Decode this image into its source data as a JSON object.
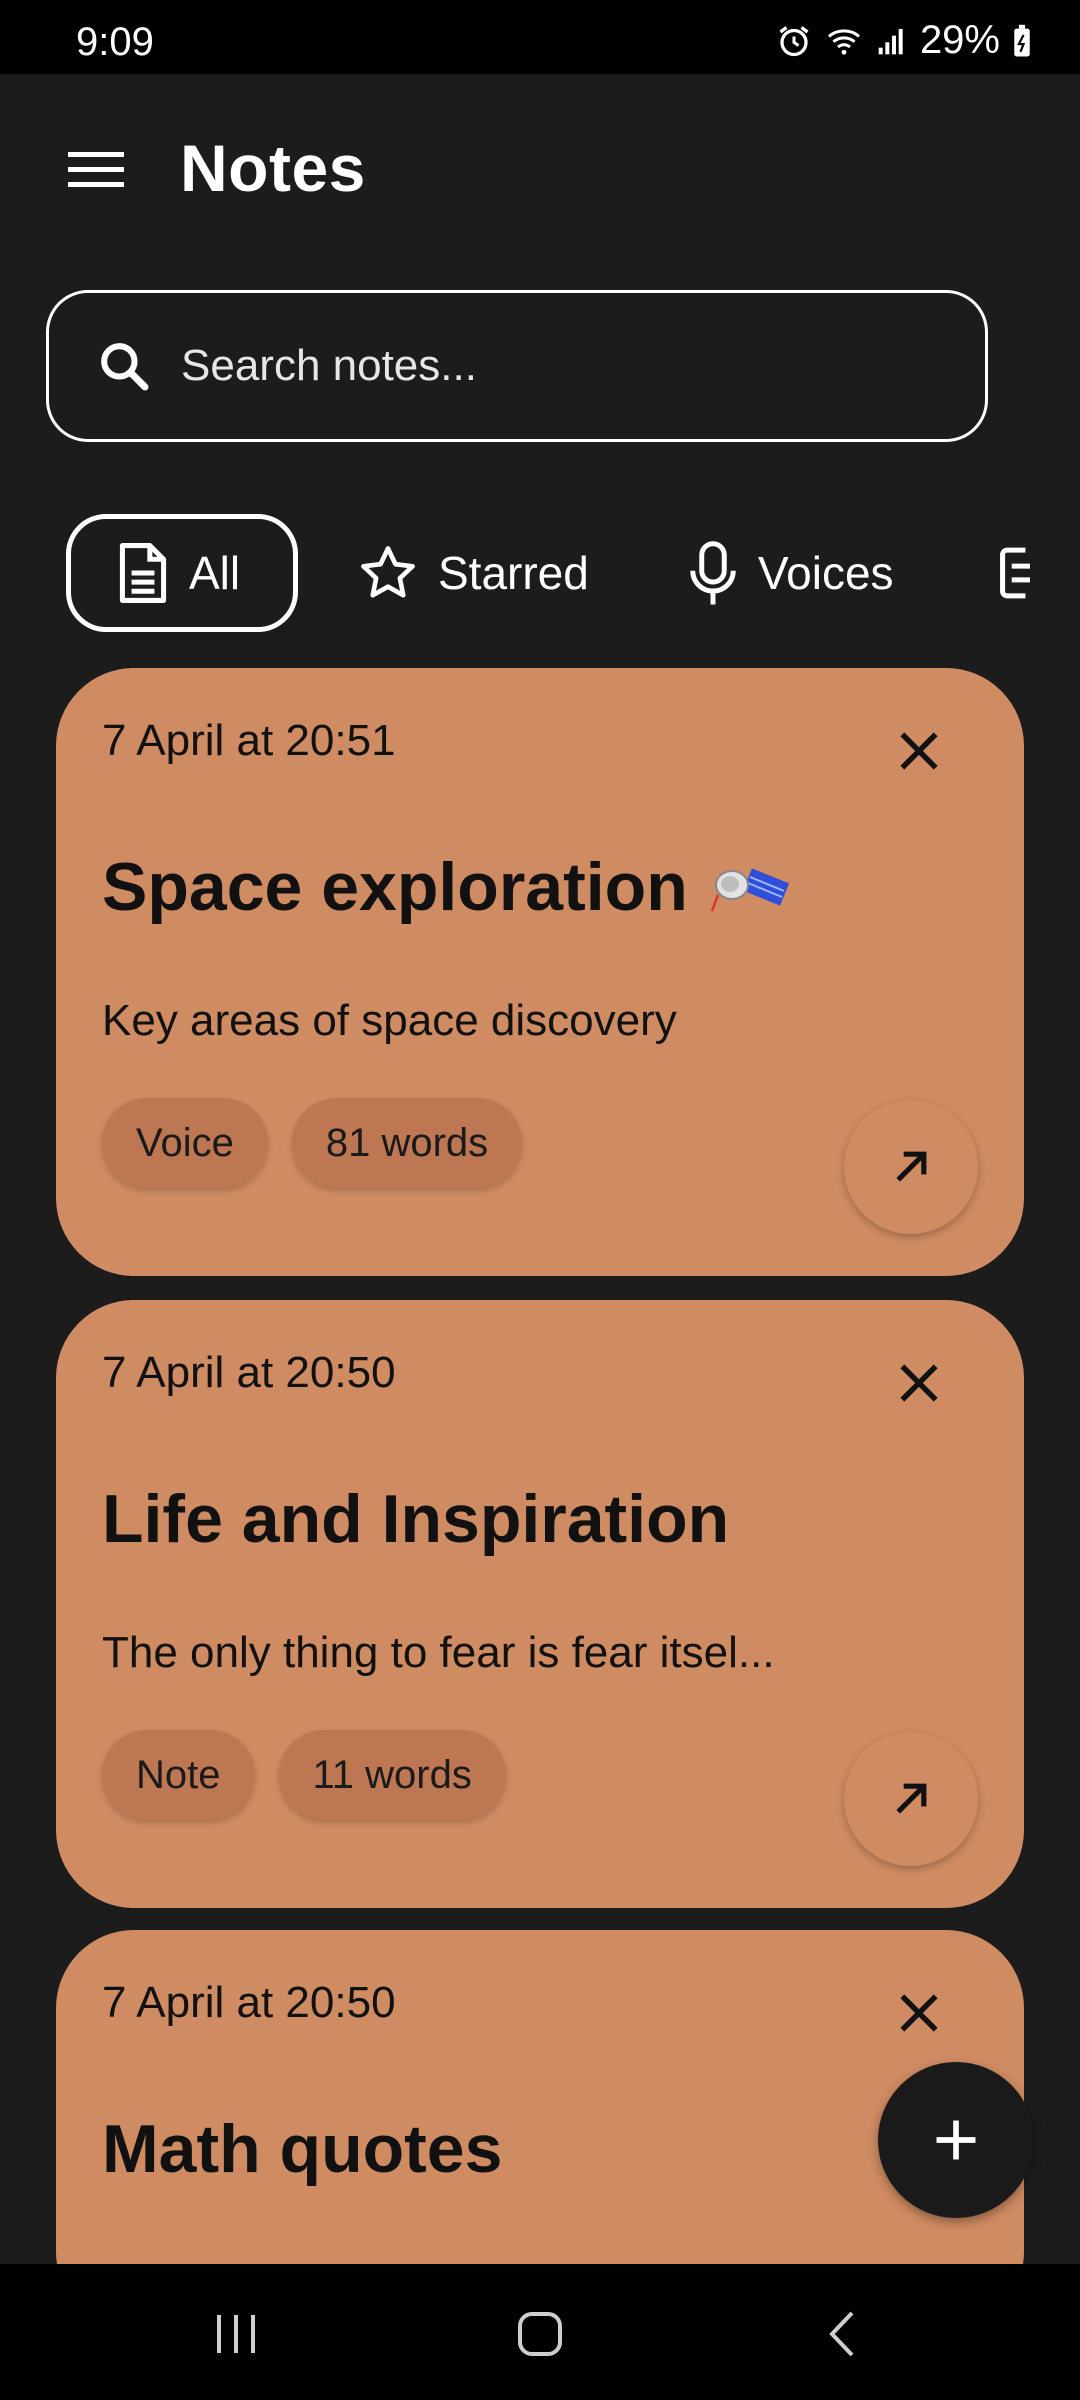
{
  "status_bar": {
    "time": "9:09",
    "battery": "29%",
    "icons": [
      "alarm-icon",
      "wifi-icon",
      "signal-icon",
      "battery-charging-icon"
    ]
  },
  "header": {
    "title": "Notes",
    "menu_icon": "hamburger-menu-icon"
  },
  "search": {
    "placeholder": "Search notes...",
    "value": ""
  },
  "filters": [
    {
      "label": "All",
      "icon": "document-icon",
      "active": true
    },
    {
      "label": "Starred",
      "icon": "star-icon",
      "active": false
    },
    {
      "label": "Voices",
      "icon": "microphone-icon",
      "active": false
    }
  ],
  "notes": [
    {
      "date": "7 April at 20:51",
      "title": "Space exploration",
      "emoji": "satellite-icon",
      "description": "Key areas of space discovery",
      "tags": [
        "Voice",
        "81 words"
      ]
    },
    {
      "date": "7 April at 20:50",
      "title": "Life and Inspiration",
      "description": "The only thing to fear is fear itsel...",
      "tags": [
        "Note",
        "11 words"
      ]
    },
    {
      "date": "7 April at 20:50",
      "title": "Math quotes"
    }
  ],
  "colors": {
    "background": "#1c1c1d",
    "card": "#cf8b62",
    "tag": "#bd7752",
    "fab": "#1a1a1a"
  }
}
